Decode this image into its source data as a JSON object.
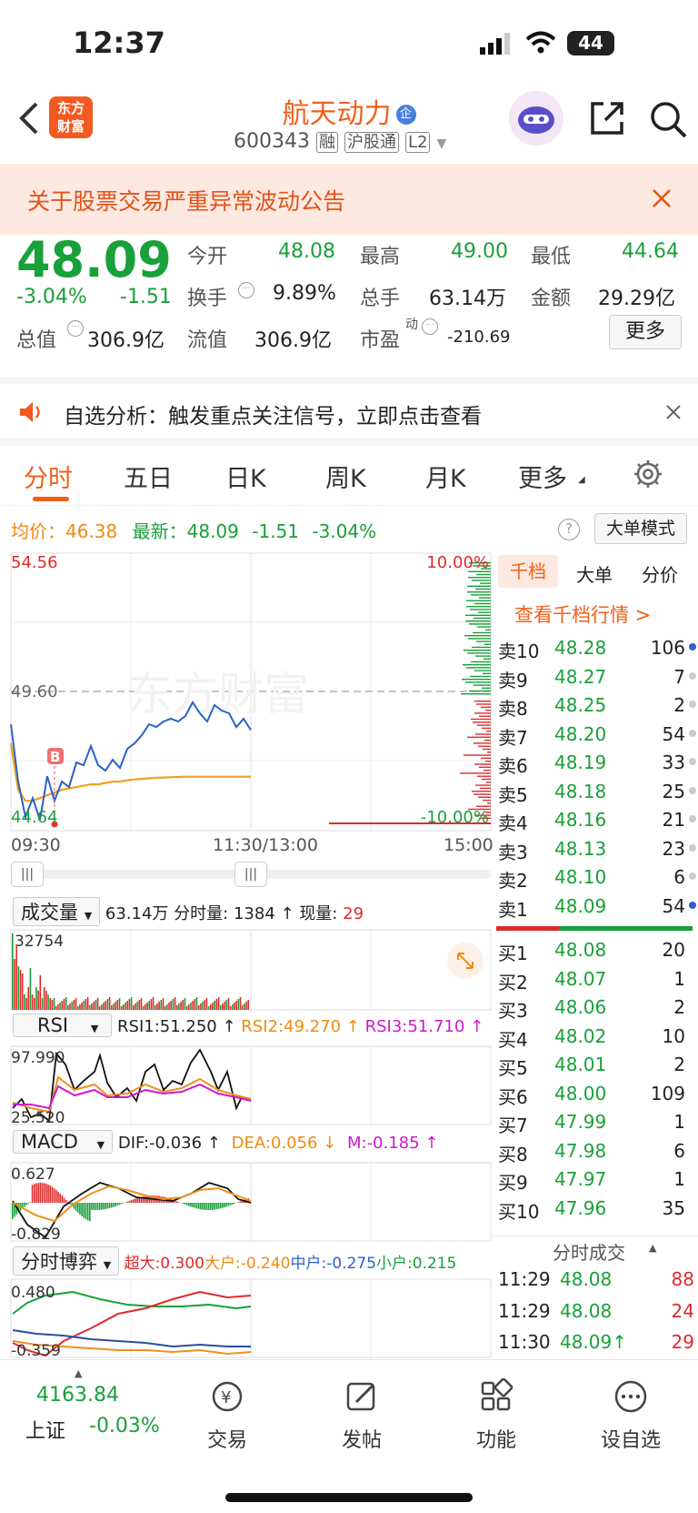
{
  "status": {
    "time": "12:37",
    "battery": "44"
  },
  "nav": {
    "title": "航天动力",
    "code": "600343",
    "badges": [
      "融",
      "沪股通",
      "L2"
    ],
    "logo_text": "东方财富"
  },
  "notice": {
    "text": "关于股票交易严重异常波动公告"
  },
  "quote": {
    "price": "48.09",
    "pct": "-3.04%",
    "chg": "-1.51",
    "open_label": "今开",
    "open": "48.08",
    "high_label": "最高",
    "high": "49.00",
    "low_label": "最低",
    "low": "44.64",
    "turnover_label": "换手",
    "turnover": "9.89%",
    "volume_label": "总手",
    "volume": "63.14万",
    "amount_label": "金额",
    "amount": "29.29亿",
    "mktcap_label": "总值",
    "mktcap": "306.9亿",
    "float_label": "流值",
    "float": "306.9亿",
    "pe_label": "市盈",
    "pe_sup": "动",
    "pe": "-210.69",
    "more": "更多"
  },
  "zixuan": {
    "text": "自选分析：触发重点关注信号，立即点击查看"
  },
  "tabs": [
    "分时",
    "五日",
    "日K",
    "周K",
    "月K",
    "更多"
  ],
  "chart": {
    "avg_label": "均价：",
    "avg": "46.38",
    "latest_label": "最新：",
    "latest": "48.09",
    "latest_chg": "-1.51",
    "latest_pct": "-3.04%",
    "big_order_mode": "大单模式",
    "ymax": "54.56",
    "ymid": "49.60",
    "ymin": "44.64",
    "pct_top": "10.00%",
    "pct_bottom": "-10.00%",
    "time_start": "09:30",
    "time_mid": "11:30/13:00",
    "time_end": "15:00",
    "b_marker": "B",
    "watermark": "东方财富"
  },
  "chart_data": {
    "type": "line",
    "title": "",
    "xlabel": "",
    "ylabel": "",
    "x_ticks": [
      "09:30",
      "11:30/13:00",
      "15:00"
    ],
    "ylim": [
      44.64,
      54.56
    ],
    "series": [
      {
        "name": "最新",
        "values": [
          48.3,
          46.2,
          44.9,
          45.6,
          44.8,
          46.4,
          45.5,
          46.2,
          46.0,
          46.9,
          46.8,
          47.5,
          46.8,
          46.6,
          47.0,
          46.7,
          47.4,
          47.6,
          47.9,
          48.3,
          48.2,
          48.4,
          48.5,
          48.4,
          48.6,
          49.1,
          48.7,
          48.4,
          49.0,
          48.8,
          48.7,
          48.2,
          48.5,
          48.09
        ]
      },
      {
        "name": "均价",
        "values": [
          47.6,
          45.9,
          45.5,
          45.5,
          45.6,
          45.7,
          45.8,
          45.9,
          45.95,
          46.0,
          46.05,
          46.1,
          46.1,
          46.15,
          46.2,
          46.2,
          46.25,
          46.28,
          46.3,
          46.32,
          46.34,
          46.35,
          46.36,
          46.37,
          46.38,
          46.38,
          46.38,
          46.38,
          46.38,
          46.38,
          46.38,
          46.38,
          46.38,
          46.38
        ]
      }
    ]
  },
  "volume_panel": {
    "label": "成交量",
    "total": "63.14万",
    "fenshi_label": "分时量:",
    "fenshi": "1384",
    "xian_label": "现量:",
    "xian": "29",
    "ymax": "32754"
  },
  "rsi_panel": {
    "label": "RSI",
    "rsi1": "RSI1:51.250",
    "rsi2": "RSI2:49.270",
    "rsi3": "RSI3:51.710",
    "ymax": "97.990",
    "ymin": "25.520"
  },
  "macd_panel": {
    "label": "MACD",
    "dif": "DIF:-0.036",
    "dea": "DEA:0.056",
    "m": "M:-0.185",
    "ymax": "0.627",
    "ymin": "-0.829"
  },
  "bo_panel": {
    "label": "分时博弈",
    "chaoda": "超大:0.300",
    "dahu": "大户:-0.240",
    "zhonghu": "中户:-0.275",
    "xiaohu": "小户:0.215",
    "ymax": "0.480",
    "ymin": "-0.359"
  },
  "book": {
    "tabs": [
      "千档",
      "大单",
      "分价"
    ],
    "link": "查看千档行情 >",
    "asks": [
      {
        "label": "卖10",
        "price": "48.28",
        "vol": "106"
      },
      {
        "label": "卖9",
        "price": "48.27",
        "vol": "7"
      },
      {
        "label": "卖8",
        "price": "48.25",
        "vol": "2"
      },
      {
        "label": "卖7",
        "price": "48.20",
        "vol": "54"
      },
      {
        "label": "卖6",
        "price": "48.19",
        "vol": "33"
      },
      {
        "label": "卖5",
        "price": "48.18",
        "vol": "25"
      },
      {
        "label": "卖4",
        "price": "48.16",
        "vol": "21"
      },
      {
        "label": "卖3",
        "price": "48.13",
        "vol": "23"
      },
      {
        "label": "卖2",
        "price": "48.10",
        "vol": "6"
      },
      {
        "label": "卖1",
        "price": "48.09",
        "vol": "54"
      }
    ],
    "bids": [
      {
        "label": "买1",
        "price": "48.08",
        "vol": "20"
      },
      {
        "label": "买2",
        "price": "48.07",
        "vol": "1"
      },
      {
        "label": "买3",
        "price": "48.06",
        "vol": "2"
      },
      {
        "label": "买4",
        "price": "48.02",
        "vol": "10"
      },
      {
        "label": "买5",
        "price": "48.01",
        "vol": "2"
      },
      {
        "label": "买6",
        "price": "48.00",
        "vol": "109"
      },
      {
        "label": "买7",
        "price": "47.99",
        "vol": "1"
      },
      {
        "label": "买8",
        "price": "47.98",
        "vol": "6"
      },
      {
        "label": "买9",
        "price": "47.97",
        "vol": "1"
      },
      {
        "label": "买10",
        "price": "47.96",
        "vol": "35"
      }
    ],
    "ticks_title": "分时成交",
    "ticks": [
      {
        "time": "11:29",
        "price": "48.08",
        "vol": "88"
      },
      {
        "time": "11:29",
        "price": "48.08",
        "vol": "24"
      },
      {
        "time": "11:30",
        "price": "48.09↑",
        "vol": "29"
      }
    ]
  },
  "bottom": {
    "index_value": "4163.84",
    "index_name": "上证",
    "index_pct": "-0.03%",
    "items": [
      "交易",
      "发帖",
      "功能",
      "设自选"
    ]
  }
}
